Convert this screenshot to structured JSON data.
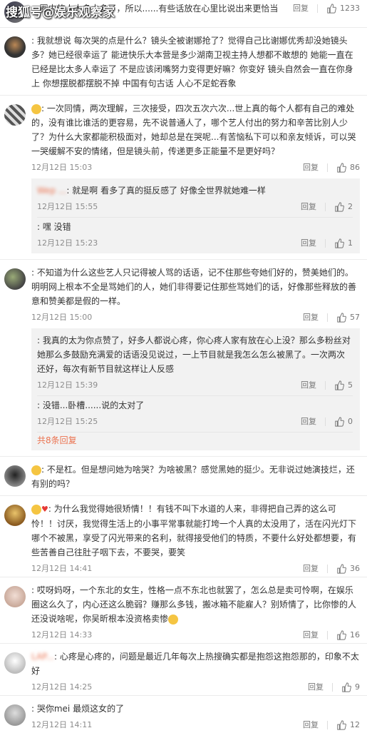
{
  "watermark": "搜狐号@娱乐观察家",
  "comments": [
    {
      "text": "...圈内的人太多太多了，所以......有些话放在心里比说出来更恰当",
      "likes": "1233",
      "reply_label": "回复"
    },
    {
      "user": "            ",
      "text": "我就想说 每次哭的点是什么？镜头全被谢娜抢了？觉得自己比谢娜优秀却没她镜头多？她已经很幸运了 能进快乐大本营是多少湖南卫视主持人想都不敢想的  她能一直在已经是比太多人幸运了 不是应该闭嘴努力变得更好嘛？你变好  镜头自然会一直在你身上 你想摆脱都摆脱不掉 中国有句古话 人心不足蛇吞象"
    },
    {
      "user": "            ",
      "text": "一次同情，两次理解，三次接受，四次五次六次...世上真的每个人都有自己的难处的，没有谁比谁活的更容易，先不说普通人了，哪个艺人付出的努力和辛苦比别人少了？为什么大家都能积极面对，她却总是在哭呢...有苦恼私下可以和亲友倾诉，可以哭一哭缓解不安的情绪，但是镜头前，传递更多正能量不是更好吗？",
      "time": "12月12日 15:03",
      "likes": "86",
      "reply_label": "回复",
      "replies": [
        {
          "user": "Wep ...",
          "text": "就是啊  看多了真的挺反感了  好像全世界就她难一样",
          "time": "12月12日 15:55",
          "likes": "2",
          "reply_label": "回复"
        },
        {
          "user": "     ",
          "text": "嘿 没错",
          "time": "12月12日 15:23",
          "likes": "1",
          "reply_label": "回复"
        }
      ]
    },
    {
      "user": "            ",
      "text": "不知道为什么这些艺人只记得被人骂的话语，记不住那些夸她们好的，赞美她们的。明明网上根本不全是骂她们的人，她们非得要记住那些骂她们的话，好像那些释放的善意和赞美都是假的一样。",
      "time": "12月12日 15:00",
      "likes": "57",
      "reply_label": "回复",
      "replies": [
        {
          "user": "        ",
          "text": "我真的太为你点赞了，好多人都说心疼，你心疼人家有放在心上没？那么多粉丝对她那么多鼓励充满爱的话语没见说过，一上节目就是我怎么怎么被黑了。一次两次还好，每次有新节目就这样让人反感",
          "time": "12月12日 15:39",
          "likes": "5",
          "reply_label": "回复"
        },
        {
          "user": "      ",
          "text": "没错...卧槽......说的太对了",
          "time": "12月12日 15:25",
          "likes": "0",
          "reply_label": "回复"
        }
      ],
      "more_replies": "共8条回复"
    },
    {
      "user": "          ",
      "text": "不是杠。但是想问她为啥哭？为啥被黑？感觉黑她的挺少。无非说过她演技烂，还有别的吗？"
    },
    {
      "user": "        ",
      "text": "为什么我觉得她很矫情！！有钱不叫下水道的人来，非得把自己弄的这么可怜！！讨厌，我觉得生活上的小事平常事就能打垮一个人真的太没用了，活在闪光灯下哪个不被黑，享受了闪光带来的名利，就得接受他们的特质，不要什么好处都想要，有些苦善自己往肚子咽下去，不要哭，要笑",
      "time": "12月12日 14:41",
      "likes": "36",
      "reply_label": "回复"
    },
    {
      "user": "          ",
      "text": "哎呀妈呀，一个东北的女生，性格一点不东北也就罢了，怎么总是卖可怜啊，在娱乐圈这么久了，内心还这么脆弱？赚那么多钱，搬冰箱不能雇人？别矫情了，比你惨的人还没说啥呢，你吴昕根本没资格卖惨",
      "time": "12月12日 14:33",
      "likes": "16",
      "reply_label": "回复"
    },
    {
      "user": "LAP...",
      "text": "心疼是心疼的，问题是最近几年每次上热搜确实都是抱怨这抱怨那的，印象不太好",
      "time": "12月12日 14:25",
      "likes": "9",
      "reply_label": "回复"
    },
    {
      "user": "        ",
      "text": "哭你mei  最烦这女的了",
      "time": "12月12日 14:11",
      "likes": "12",
      "reply_label": "回复"
    }
  ]
}
